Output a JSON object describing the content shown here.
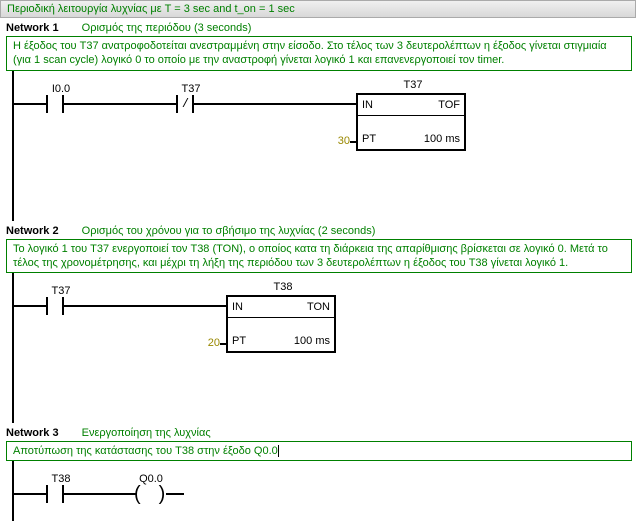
{
  "program_title": "Περιοδική λειτουργία λυχνίας με T = 3 sec and t_on = 1 sec",
  "networks": [
    {
      "label": "Network 1",
      "title": "Ορισμός της περιόδου (3 seconds)",
      "comment": "Η έξοδος του T37 ανατροφοδοτείται ανεστραμμένη στην είσοδο. Στο τέλος των 3 δευτερολέπτων η έξοδος γίνεται στιγμιαία (για 1 scan cycle) λογικό 0 το οποίο με την αναστροφή γίνεται λογικό 1 και επανενεργοποιεί τον timer.",
      "contacts": [
        {
          "label": "I0.0",
          "type": "NO"
        },
        {
          "label": "T37",
          "type": "NC"
        }
      ],
      "timer": {
        "name": "T37",
        "kind": "TOF",
        "in_label": "IN",
        "pt_label": "PT",
        "preset": "30",
        "timebase": "100 ms"
      }
    },
    {
      "label": "Network 2",
      "title": "Ορισμός του χρόνου για το σβήσιμο της λυχνίας (2 seconds)",
      "comment": "Το λογικό 1 του T37 ενεργοποιεί τον T38 (TON), ο οποίος κατα τη διάρκεια της απαρίθμισης βρίσκεται σε λογικό 0.  Μετά το τέλος της χρονομέτρησης, και μέχρι τη λήξη της περιόδου των 3 δευτερολέπτων η έξοδος του T38 γίνεται λογικό 1.",
      "contacts": [
        {
          "label": "T37",
          "type": "NO"
        }
      ],
      "timer": {
        "name": "T38",
        "kind": "TON",
        "in_label": "IN",
        "pt_label": "PT",
        "preset": "20",
        "timebase": "100 ms"
      }
    },
    {
      "label": "Network 3",
      "title": "Ενεργοποίηση της λυχνίας",
      "comment": "Αποτύπωση της κατάστασης του T38 στην έξοδο Q0.0",
      "contacts": [
        {
          "label": "T38",
          "type": "NO"
        }
      ],
      "coil": {
        "label": "Q0.0"
      }
    }
  ]
}
